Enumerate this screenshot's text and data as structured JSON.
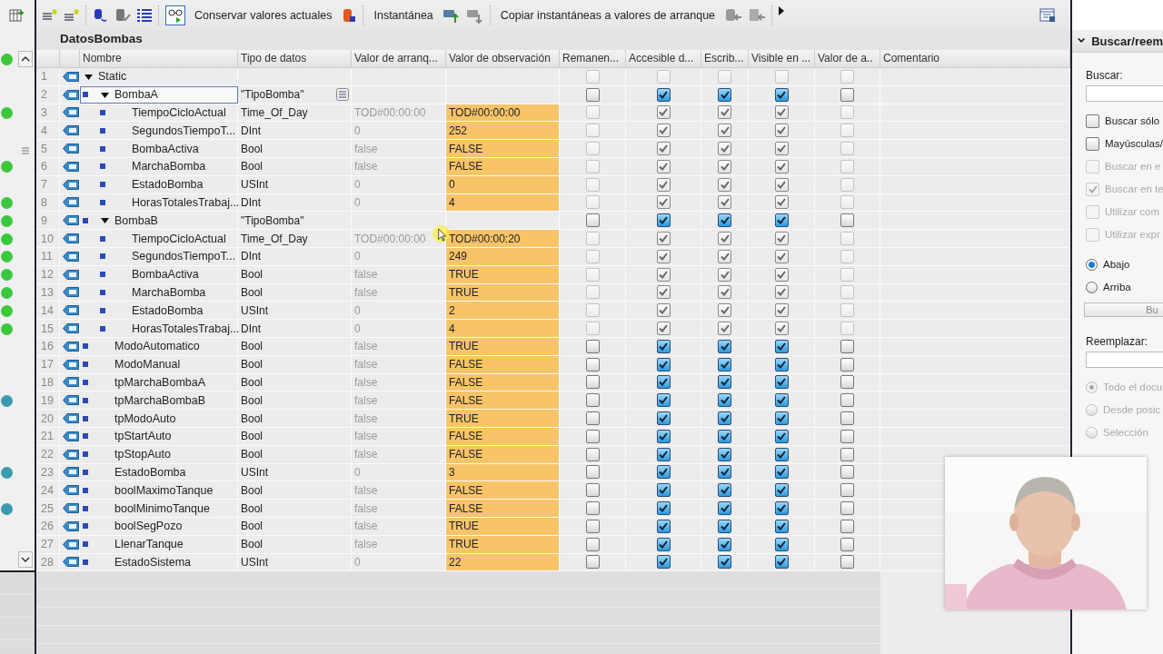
{
  "toolbar": {
    "buttons": [
      "Conservar valores actuales",
      "Instantánea",
      "Copiar instantáneas a valores de arranque"
    ]
  },
  "left_pane": {
    "color": "#3cc83c"
  },
  "block": {
    "title": "DatosBombas"
  },
  "table": {
    "columns": [
      "Nombre",
      "Tipo de datos",
      "Valor de arranq...",
      "Valor de observación",
      "Remanen...",
      "Accesible d...",
      "Escrib...",
      "Visible en ...",
      "Valor de a..",
      "Comentario"
    ],
    "rows": [
      {
        "num": "1",
        "name": "Static",
        "expanded": true,
        "selected": false,
        "disabled": true,
        "checks": [
          false,
          false,
          false,
          false,
          false
        ],
        "children": [
          {
            "num": "2",
            "name": "BombaA",
            "type": "\"TipoBomba\"",
            "expanded": true,
            "selected": true,
            "disabled": false,
            "checks": [
              false,
              true,
              true,
              true,
              false
            ],
            "children": [
              {
                "num": "3",
                "name": "TiempoCicloActual",
                "type": "Time_Of_Day",
                "start": "TOD#00:00:00",
                "watch": "TOD#00:00:00",
                "color": "#3cc83c",
                "selected": false,
                "disabled": true,
                "checks": [
                  false,
                  true,
                  true,
                  true,
                  false
                ]
              },
              {
                "num": "4",
                "name": "SegundosTiempoT...",
                "type": "DInt",
                "start": "0",
                "watch": "252",
                "selected": false,
                "disabled": true,
                "checks": [
                  false,
                  true,
                  true,
                  true,
                  false
                ]
              },
              {
                "num": "5",
                "name": "BombaActiva",
                "type": "Bool",
                "start": "false",
                "watch": "FALSE",
                "selected": false,
                "disabled": true,
                "checks": [
                  false,
                  true,
                  true,
                  true,
                  false
                ]
              },
              {
                "num": "6",
                "name": "MarchaBomba",
                "type": "Bool",
                "start": "false",
                "watch": "FALSE",
                "color": "#3cc83c",
                "selected": false,
                "disabled": true,
                "checks": [
                  false,
                  true,
                  true,
                  true,
                  false
                ]
              },
              {
                "num": "7",
                "name": "EstadoBomba",
                "type": "USInt",
                "start": "0",
                "watch": "0",
                "selected": false,
                "disabled": true,
                "checks": [
                  false,
                  true,
                  true,
                  true,
                  false
                ]
              },
              {
                "num": "8",
                "name": "HorasTotalesTrabaj...",
                "type": "DInt",
                "start": "0",
                "watch": "4",
                "color": "#3cc83c",
                "selected": false,
                "disabled": true,
                "checks": [
                  false,
                  true,
                  true,
                  true,
                  false
                ]
              }
            ]
          },
          {
            "num": "9",
            "name": "BombaB",
            "type": "\"TipoBomba\"",
            "expanded": true,
            "color": "#3cc83c",
            "selected": false,
            "disabled": false,
            "checks": [
              false,
              true,
              true,
              true,
              false
            ],
            "children": [
              {
                "num": "10",
                "name": "TiempoCicloActual",
                "type": "Time_Of_Day",
                "start": "TOD#00:00:00",
                "watch": "TOD#00:00:20",
                "color": "#3cc83c",
                "selected": false,
                "disabled": true,
                "checks": [
                  false,
                  true,
                  true,
                  true,
                  false
                ]
              },
              {
                "num": "11",
                "name": "SegundosTiempoT...",
                "type": "DInt",
                "start": "0",
                "watch": "249",
                "color": "#3cc83c",
                "selected": false,
                "disabled": true,
                "checks": [
                  false,
                  true,
                  true,
                  true,
                  false
                ]
              },
              {
                "num": "12",
                "name": "BombaActiva",
                "type": "Bool",
                "start": "false",
                "watch": "TRUE",
                "color": "#3cc83c",
                "selected": false,
                "disabled": true,
                "checks": [
                  false,
                  true,
                  true,
                  true,
                  false
                ]
              },
              {
                "num": "13",
                "name": "MarchaBomba",
                "type": "Bool",
                "start": "false",
                "watch": "TRUE",
                "color": "#3cc83c",
                "selected": false,
                "disabled": true,
                "checks": [
                  false,
                  true,
                  true,
                  true,
                  false
                ]
              },
              {
                "num": "14",
                "name": "EstadoBomba",
                "type": "USInt",
                "start": "0",
                "watch": "2",
                "color": "#3cc83c",
                "selected": false,
                "disabled": true,
                "checks": [
                  false,
                  true,
                  true,
                  true,
                  false
                ]
              },
              {
                "num": "15",
                "name": "HorasTotalesTrabaj...",
                "type": "DInt",
                "start": "0",
                "watch": "4",
                "color": "#3cc83c",
                "selected": false,
                "disabled": true,
                "checks": [
                  false,
                  true,
                  true,
                  true,
                  false
                ]
              }
            ]
          },
          {
            "num": "16",
            "name": "ModoAutomatico",
            "type": "Bool",
            "start": "false",
            "watch": "TRUE",
            "selected": false,
            "disabled": false,
            "checks": [
              false,
              true,
              true,
              true,
              false
            ]
          },
          {
            "num": "17",
            "name": "ModoManual",
            "type": "Bool",
            "start": "false",
            "watch": "FALSE",
            "selected": false,
            "disabled": false,
            "checks": [
              false,
              true,
              true,
              true,
              false
            ]
          },
          {
            "num": "18",
            "name": "tpMarchaBombaA",
            "type": "Bool",
            "start": "false",
            "watch": "FALSE",
            "selected": false,
            "disabled": false,
            "checks": [
              false,
              true,
              true,
              true,
              false
            ]
          },
          {
            "num": "19",
            "name": "tpMarchaBombaB",
            "type": "Bool",
            "start": "false",
            "watch": "FALSE",
            "color": "#3a9ab0",
            "selected": false,
            "disabled": false,
            "checks": [
              false,
              true,
              true,
              true,
              false
            ]
          },
          {
            "num": "20",
            "name": "tpModoAuto",
            "type": "Bool",
            "start": "false",
            "watch": "TRUE",
            "selected": false,
            "disabled": false,
            "checks": [
              false,
              true,
              true,
              true,
              false
            ]
          },
          {
            "num": "21",
            "name": "tpStartAuto",
            "type": "Bool",
            "start": "false",
            "watch": "FALSE",
            "selected": false,
            "disabled": false,
            "checks": [
              false,
              true,
              true,
              true,
              false
            ]
          },
          {
            "num": "22",
            "name": "tpStopAuto",
            "type": "Bool",
            "start": "false",
            "watch": "FALSE",
            "selected": false,
            "disabled": false,
            "checks": [
              false,
              true,
              true,
              true,
              false
            ]
          },
          {
            "num": "23",
            "name": "EstadoBomba",
            "type": "USInt",
            "start": "0",
            "watch": "3",
            "color": "#3a9ab0",
            "selected": false,
            "disabled": false,
            "checks": [
              false,
              true,
              true,
              true,
              false
            ]
          },
          {
            "num": "24",
            "name": "boolMaximoTanque",
            "type": "Bool",
            "start": "false",
            "watch": "FALSE",
            "selected": false,
            "disabled": false,
            "checks": [
              false,
              true,
              true,
              true,
              false
            ]
          },
          {
            "num": "25",
            "name": "boolMinimoTanque",
            "type": "Bool",
            "start": "false",
            "watch": "FALSE",
            "color": "#3a9ab0",
            "selected": false,
            "disabled": false,
            "checks": [
              false,
              true,
              true,
              true,
              false
            ]
          },
          {
            "num": "26",
            "name": "boolSegPozo",
            "type": "Bool",
            "start": "false",
            "watch": "TRUE",
            "selected": false,
            "disabled": false,
            "checks": [
              false,
              true,
              true,
              true,
              false
            ]
          },
          {
            "num": "27",
            "name": "LlenarTanque",
            "type": "Bool",
            "start": "false",
            "watch": "TRUE",
            "selected": false,
            "disabled": false,
            "checks": [
              false,
              true,
              true,
              true,
              false
            ]
          },
          {
            "num": "28",
            "name": "EstadoSistema",
            "type": "USInt",
            "start": "0",
            "watch": "22",
            "selected": false,
            "disabled": false,
            "checks": [
              false,
              true,
              true,
              true,
              false
            ]
          }
        ]
      }
    ]
  },
  "find_panel": {
    "title": "Buscar/reem",
    "search_label": "Buscar:",
    "options": [
      {
        "label": "Buscar sólo",
        "checked": false,
        "disabled": false
      },
      {
        "label": "Mayúsculas/",
        "checked": false,
        "disabled": false
      },
      {
        "label": "Buscar en e",
        "checked": false,
        "disabled": true
      },
      {
        "label": "Buscar en te",
        "checked": true,
        "disabled": true
      },
      {
        "label": "Utilizar com",
        "checked": false,
        "disabled": true
      },
      {
        "label": "Utilizar expr",
        "checked": false,
        "disabled": true
      }
    ],
    "direction": [
      {
        "label": "Abajo",
        "selected": true
      },
      {
        "label": "Arriba",
        "selected": false
      }
    ],
    "search_button": "Bu",
    "replace_label": "Reemplazar:",
    "scope": [
      {
        "label": "Todo el docu",
        "selected": true,
        "disabled": true
      },
      {
        "label": "Desde posic",
        "selected": false,
        "disabled": true
      },
      {
        "label": "Selección",
        "selected": false,
        "disabled": true
      }
    ]
  }
}
